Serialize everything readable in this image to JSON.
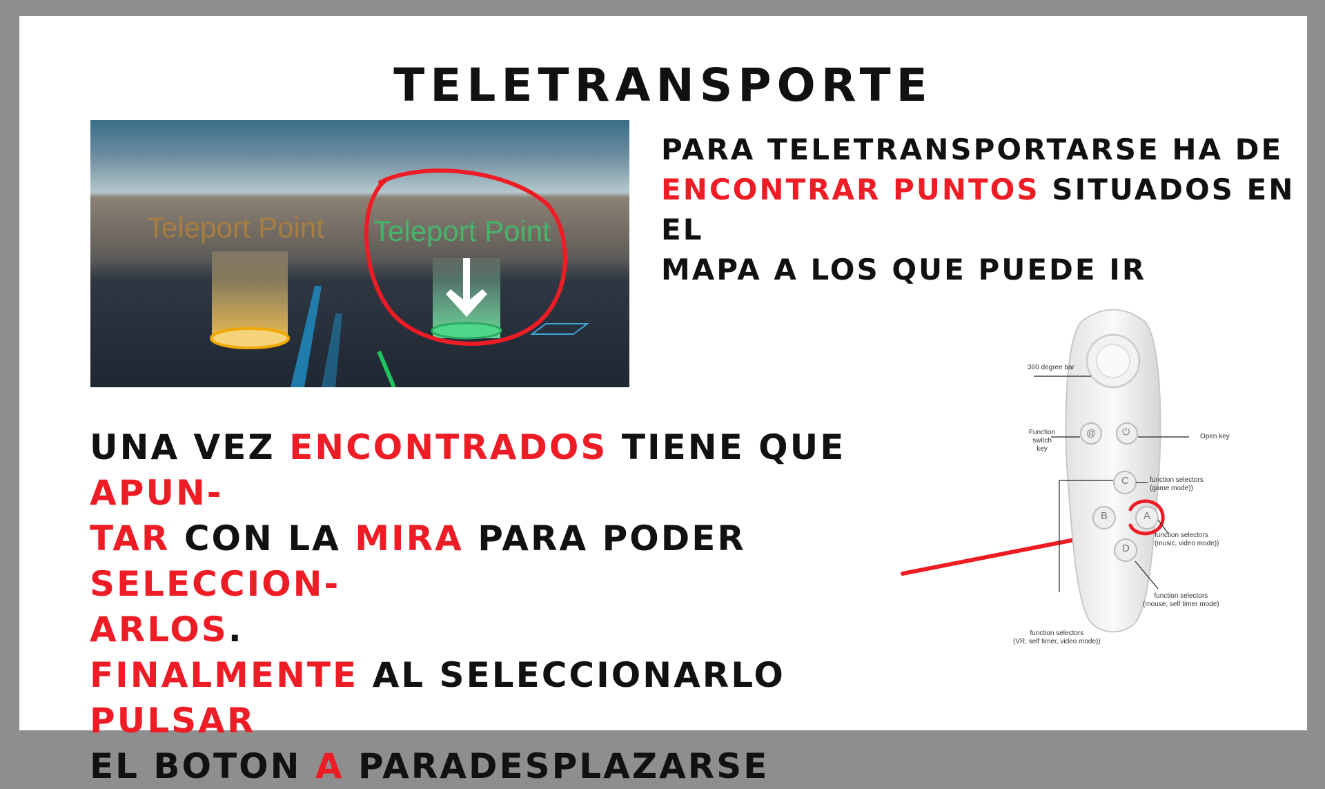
{
  "title": "Teletransporte",
  "screenshot": {
    "label_left": "Teleport Point",
    "label_right": "Teleport Point"
  },
  "desc1": {
    "line1": "Para teletransportarse ha de",
    "line2_red": "encontrar puntos",
    "line2_rest": " situados en el",
    "line3": "mapa a los que puede ir"
  },
  "desc2": {
    "p1": "Una vez ",
    "p2_red": "encontrados",
    "p3": " tiene que ",
    "p4_red": "apun-",
    "p5_red": "tar",
    "p6": " con la ",
    "p7_red": "mira",
    "p8": " para poder ",
    "p9_red": "seleccion-",
    "p10_red": "arlos",
    "p11": ".",
    "p12_red": "Finalmente",
    "p13": " al seleccionarlo ",
    "p14_red": "pulsar",
    "p15": "el boton ",
    "p16_red": "A",
    "p17": " paradesplazarse"
  },
  "controller": {
    "bar_label": "360 degree bar",
    "function_switch_label": "Function\nswitch key",
    "open_key_label": "Open key",
    "c_label": "function selectors\n(game mode))",
    "a_label": "function selectors\n(music, video mode))",
    "d_label": "function selectors\n(mouse, self timer mode)",
    "bottom_label": "function selectors\n(VR, self timer, video mode))",
    "btn_c": "C",
    "btn_b": "B",
    "btn_a": "A",
    "btn_d": "D",
    "btn_at": "@"
  },
  "colors": {
    "accent_red": "#ee1c25",
    "frame_gray": "#8e8e8e"
  }
}
